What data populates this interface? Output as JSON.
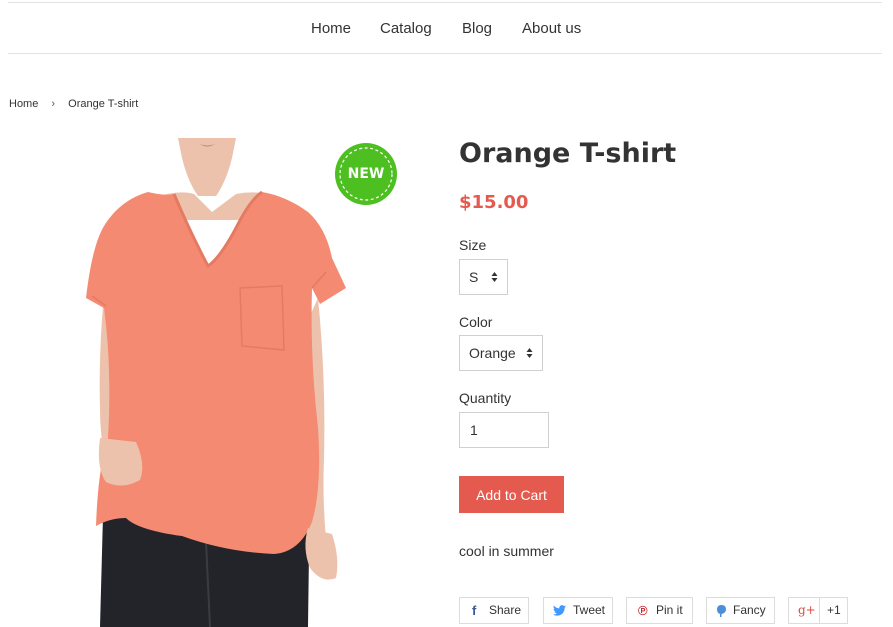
{
  "nav": {
    "items": [
      "Home",
      "Catalog",
      "Blog",
      "About us"
    ]
  },
  "breadcrumb": {
    "home": "Home",
    "separator": "›",
    "current": "Orange T-shirt"
  },
  "product": {
    "badge": "NEW",
    "title": "Orange T-shirt",
    "price": "$15.00",
    "description": "cool in summer",
    "image": "model-wearing-orange-t-shirt"
  },
  "options": {
    "size_label": "Size",
    "size_value": "S",
    "color_label": "Color",
    "color_value": "Orange",
    "quantity_label": "Quantity",
    "quantity_value": "1"
  },
  "cart": {
    "add_label": "Add to Cart"
  },
  "share": {
    "facebook": "Share",
    "twitter": "Tweet",
    "pinterest": "Pin it",
    "fancy": "Fancy",
    "google_icon": "g+",
    "google": "+1"
  },
  "colors": {
    "accent": "#e55a4e",
    "badge_green": "#4ebf21",
    "shirt": "#f58a73",
    "border": "#e3e3e3"
  }
}
